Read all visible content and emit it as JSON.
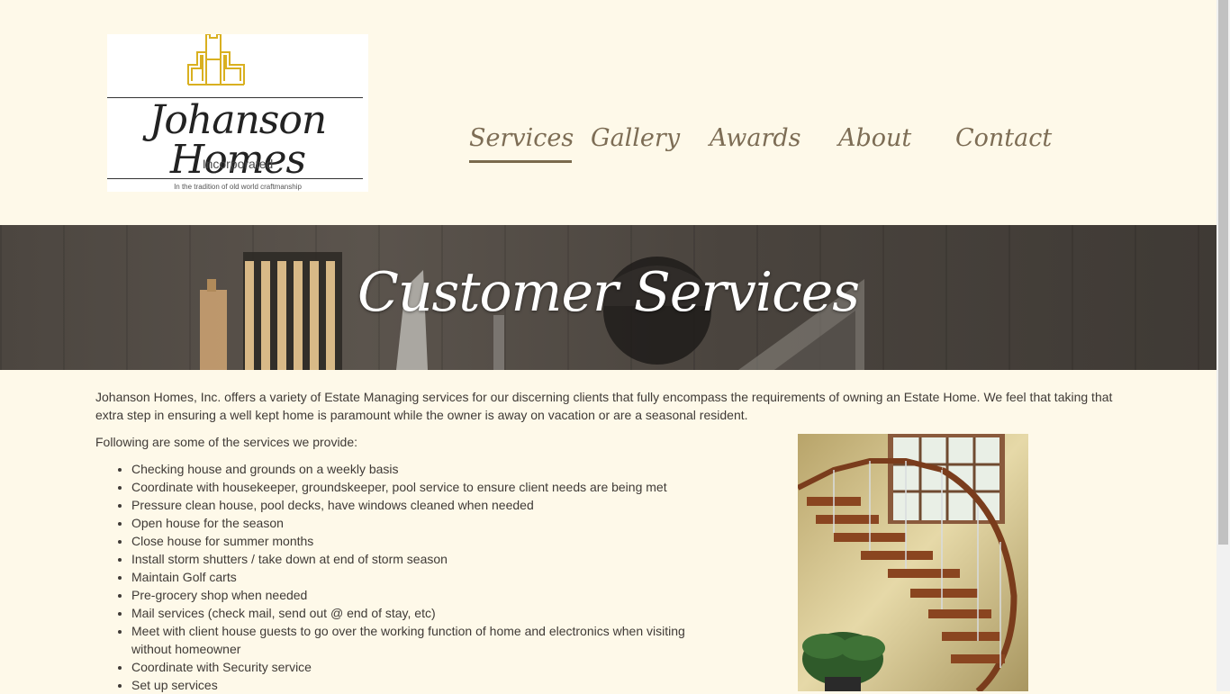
{
  "brand": {
    "name": "Johanson Homes",
    "subtitle": "Incorporated",
    "tagline": "In the tradition of old world craftmanship",
    "gold": "#d9b020"
  },
  "nav": {
    "items": [
      {
        "label": "Services",
        "active": true
      },
      {
        "label": "Gallery",
        "active": false
      },
      {
        "label": "Awards",
        "active": false
      },
      {
        "label": "About",
        "active": false
      },
      {
        "label": "Contact",
        "active": false
      }
    ]
  },
  "hero": {
    "title": "Customer Services"
  },
  "content": {
    "intro": "Johanson Homes, Inc. offers a variety of Estate Managing services for our discerning clients that fully encompass the requirements of owning an Estate Home. We feel that taking that extra step in ensuring a well kept home is paramount while the owner is away on vacation or are a seasonal resident.",
    "list_intro": "Following are some of the services we provide:",
    "services": [
      "Checking house and grounds on a weekly basis",
      "Coordinate with housekeeper, groundskeeper, pool service to ensure client needs are being met",
      "Pressure clean house, pool decks, have windows cleaned when needed",
      "Open house for the season",
      "Close house for summer months",
      "Install storm shutters / take down at end of storm season",
      "Maintain Golf carts",
      "Pre-grocery shop when needed",
      "Mail services (check mail, send out @ end of stay, etc)",
      "Meet with client house guests to go over the working function of home and electronics when visiting without homeowner",
      "Coordinate with Security service",
      "Set up services"
    ]
  },
  "colors": {
    "page_bg": "#fef9e9",
    "nav_text": "#7d6d55",
    "nav_underline": "#7a6a4d",
    "hero_text": "#ffffff"
  }
}
